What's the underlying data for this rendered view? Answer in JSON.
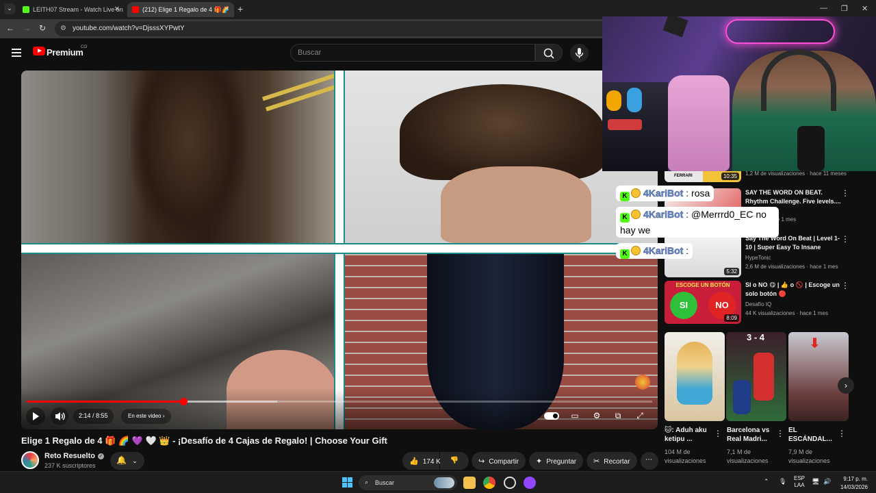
{
  "browser": {
    "tabs": [
      {
        "label": "LEITH07 Stream - Watch Live on",
        "favicon_color": "#53fc18"
      },
      {
        "label": "(212) Elige 1 Regalo de 4 🎁🌈",
        "favicon_color": "#ff0000",
        "active": true
      }
    ],
    "url": "youtube.com/watch?v=DjsssXYPwtY"
  },
  "youtube": {
    "brand": "Premium",
    "country": "CO",
    "search_placeholder": "Buscar"
  },
  "player": {
    "time": "2:14 / 8:55",
    "chapter": "En este video",
    "progress_fraction": 0.25,
    "buffer_fraction": 0.4
  },
  "video": {
    "title": "Elige 1 Regalo de 4 🎁 🌈 💜 🤍 👑 - ¡Desafío de 4 Cajas de Regalo! | Choose Your Gift",
    "channel": "Reto Resuelto",
    "subscribers": "237 K suscriptores",
    "likes": "174 K",
    "share": "Compartir",
    "ask": "Preguntar",
    "clip": "Recortar"
  },
  "recommendations": [
    {
      "title": "",
      "channel": "",
      "meta": "1,2 M de visualizaciones · hace 11 meses",
      "duration": "10:35",
      "label": "FERRARI"
    },
    {
      "title": "SAY THE WORD ON BEAT. Rhythm Challenge. Five levels....",
      "channel": "",
      "meta": "...iones · hace 1 mes",
      "duration": ""
    },
    {
      "title": "Say The Word On Beat | Level 1-10 | Super Easy To Insane",
      "channel": "HypeTonic",
      "meta": "2,6 M de visualizaciones · hace 1 mes",
      "duration": "5:32"
    },
    {
      "title": "SI o NO 😋 | 👍 o 🚫 | Escoge un solo botón 🔴",
      "channel": "Desafío IQ",
      "meta": "44 K visualizaciones · hace 1 mes",
      "duration": "8:09",
      "thumb_title": "ESCOGE UN BOTÓN",
      "yes": "SI",
      "no": "NO"
    }
  ],
  "shorts": [
    {
      "title": "🐱: Aduh aku ketipu ...",
      "views": "104 M de visualizaciones"
    },
    {
      "title": "Barcelona vs Real Madri...",
      "views": "7,1 M de visualizaciones",
      "score": "3 - 4"
    },
    {
      "title": "EL ESCÁNDAL...",
      "views": "7,9 M de visualizaciones"
    }
  ],
  "chat": [
    {
      "user": "4KariBot",
      "message": "rosa"
    },
    {
      "user": "4KariBot",
      "message": "@Merrrd0_EC no hay we"
    },
    {
      "user": "4KariBot",
      "message": ""
    }
  ],
  "taskbar": {
    "search": "Buscar",
    "lang": "ESP",
    "lang2": "LAA",
    "time": "9:17 p. m.",
    "date": "14/03/2026"
  }
}
